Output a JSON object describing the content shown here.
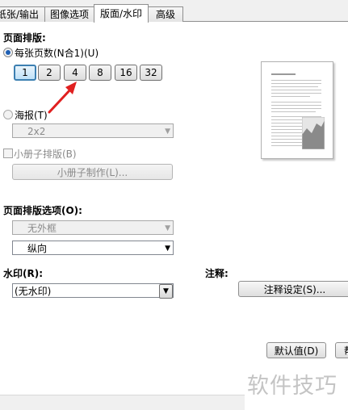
{
  "tabs": [
    {
      "label": "纸张/输出"
    },
    {
      "label": "图像选项"
    },
    {
      "label": "版面/水印"
    },
    {
      "label": "高级"
    }
  ],
  "page_layout": {
    "heading": "页面排版:",
    "nup_radio_label": "每张页数(N合1)(U)",
    "nup_options": [
      "1",
      "2",
      "4",
      "8",
      "16",
      "32"
    ],
    "nup_selected": "1",
    "poster_radio_label": "海报(T)",
    "poster_value": "2x2",
    "booklet_checkbox_label": "小册子排版(B)",
    "booklet_button_label": "小册子制作(L)..."
  },
  "layout_options": {
    "heading": "页面排版选项(O):",
    "border_value": "无外框",
    "orientation_value": "纵向"
  },
  "watermark": {
    "heading": "水印(R):",
    "value": "(无水印)"
  },
  "annotation": {
    "heading": "注释:",
    "button_label": "注释设定(S)..."
  },
  "footer": {
    "default_button_label": "默认值(D)",
    "next_button_label": "帮"
  },
  "overlay": {
    "site_watermark": "软件技巧",
    "arrow_color": "#e02020"
  },
  "colors": {
    "selected_border": "#3c7fb1",
    "radio_dot": "#1e5fb4"
  }
}
